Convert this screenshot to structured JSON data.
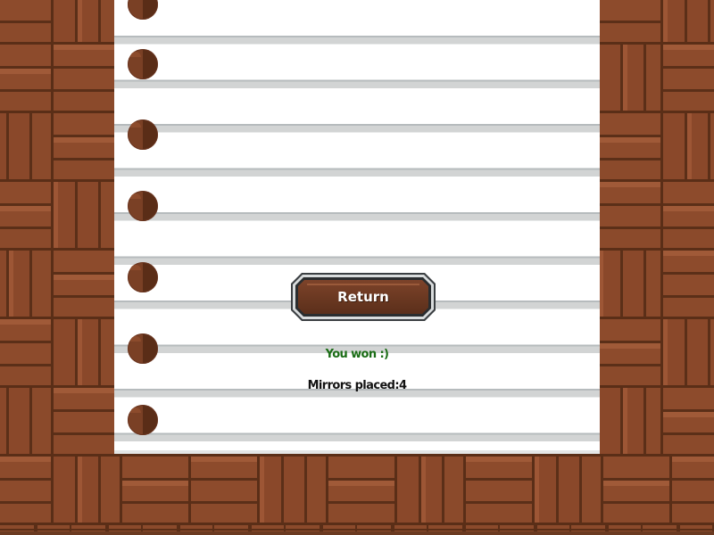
{
  "return_button": {
    "label": "Return"
  },
  "result": {
    "win_message": "You won :)",
    "mirrors_label": "Mirrors placed:",
    "mirrors_count": "4"
  },
  "colors": {
    "wood": "#8b4a2b",
    "wood_dark": "#5a2e17",
    "paper": "#ffffff",
    "paper_line": "#b6bbbd",
    "win_text": "#1b6d16",
    "button_face": "#6a3821"
  },
  "icons": {
    "binder_hole": "binder-hole-icon"
  }
}
